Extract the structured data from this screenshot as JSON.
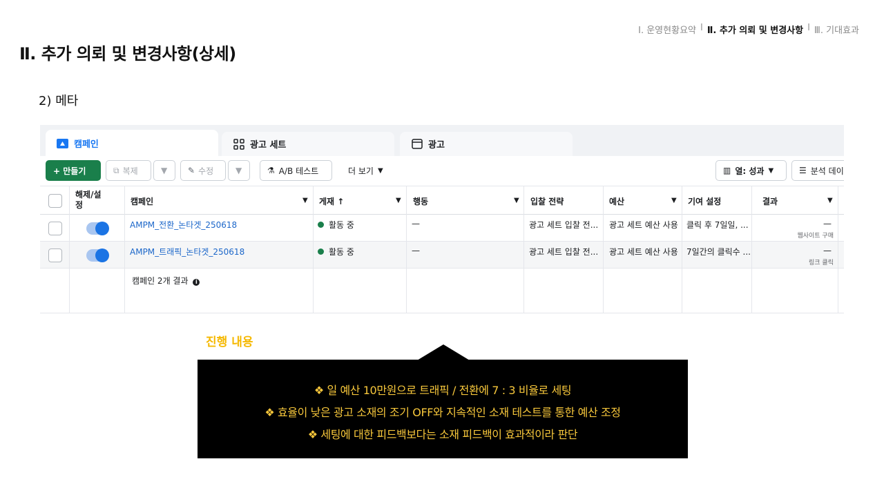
{
  "nav": {
    "item1": "Ⅰ. 운영현황요약",
    "sep1": "I",
    "item2": "Ⅱ. 추가 의뢰 및 변경사항",
    "sep2": "I",
    "item3": "Ⅲ. 기대효과"
  },
  "page_title": "Ⅱ. 추가 의뢰 및 변경사항(상세)",
  "section_subtitle": "2) 메타",
  "tabs": [
    {
      "label": "캠페인",
      "icon": "folder-icon"
    },
    {
      "label": "광고 세트",
      "icon": "grid-icon"
    },
    {
      "label": "광고",
      "icon": "window-icon"
    }
  ],
  "toolbar": {
    "create": "+ 만들기",
    "duplicate": "복제",
    "edit": "수정",
    "ab_test": "A/B 테스트",
    "more": "더 보기",
    "columns": "열: 성과",
    "breakdown": "분석 데이"
  },
  "headers": {
    "onoff": "해제/설정",
    "campaign": "캠페인",
    "delivery": "게재 ↑",
    "actions": "행동",
    "bid": "입찰 전략",
    "budget": "예산",
    "attribution": "기여 설정",
    "results": "결과"
  },
  "rows": [
    {
      "name": "AMPM_전환_논타겟_250618",
      "delivery": "활동 중",
      "actions": "—",
      "bid": "광고 세트 입찰 전...",
      "budget": "광고 세트 예산 사용",
      "attribution": "클릭 후 7일일, ...",
      "result": "—",
      "result_sub": "웹사이트 구매",
      "active": true
    },
    {
      "name": "AMPM_트래픽_논타겟_250618",
      "delivery": "활동 중",
      "actions": "—",
      "bid": "광고 세트 입찰 전...",
      "budget": "광고 세트 예산 사용",
      "attribution": "7일간의 클릭수 ...",
      "result": "—",
      "result_sub": "링크 클릭",
      "active": true
    }
  ],
  "summary": "캠페인 2개 결과",
  "progress_title": "진행 내용",
  "callout_lines": [
    "❖ 일 예산 10만원으로 트래픽 / 전환에 7 : 3 비율로 세팅",
    "❖ 효율이 낮은 광고 소재의 조기 OFF와 지속적인 소재 테스트를 통한 예산 조정",
    "❖ 세팅에 대한 피드백보다는 소재 피드백이 효과적이라 판단"
  ],
  "colors": {
    "accent_yellow": "#f5b800",
    "meta_blue": "#1877f2",
    "create_green": "#1a7f4b"
  }
}
